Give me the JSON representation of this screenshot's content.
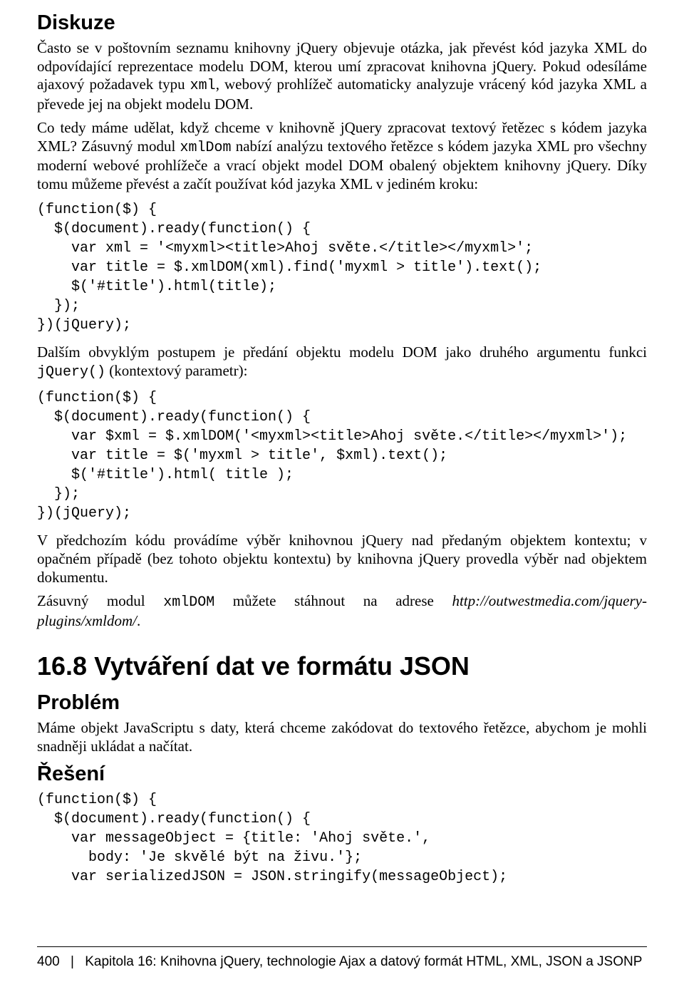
{
  "headings": {
    "diskuze": "Diskuze",
    "section": "16.8  Vytváření dat ve formátu JSON",
    "problem": "Problém",
    "reseni": "Řešení"
  },
  "p1a": "Často se v poštovním seznamu knihovny jQuery objevuje otázka, jak převést kód jazyka XML do odpovídající reprezentace modelu DOM, kterou umí zpracovat knihovna jQuery. Pokud odesíláme ajaxový požadavek typu ",
  "p1code": "xml",
  "p1b": ", webový prohlížeč automaticky analyzuje vrácený kód jazyka XML a převede jej na objekt modelu DOM.",
  "p2a": "Co tedy máme udělat, když chceme v knihovně jQuery zpracovat textový řetězec s kódem jazyka XML? Zásuvný modul ",
  "p2code": "xmlDom",
  "p2b": " nabízí analýzu textového řetězce s kódem jazyka XML pro všechny moderní webové prohlížeče a vrací objekt model DOM obalený objektem knihovny jQuery. Díky tomu můžeme převést a začít používat kód jazyka XML v jediném kroku:",
  "code1": "(function($) {\n  $(document).ready(function() {\n    var xml = '<myxml><title>Ahoj světe.</title></myxml>';\n    var title = $.xmlDOM(xml).find('myxml > title').text();\n    $('#title').html(title);\n  });\n})(jQuery);",
  "p3a": "Dalším obvyklým postupem je předání objektu modelu DOM jako druhého argumentu funkci ",
  "p3code": "jQuery()",
  "p3b": " (kontextový parametr):",
  "code2": "(function($) {\n  $(document).ready(function() {\n    var $xml = $.xmlDOM('<myxml><title>Ahoj světe.</title></myxml>');\n    var title = $('myxml > title', $xml).text();\n    $('#title').html( title );\n  });\n})(jQuery);",
  "p4": "V předchozím kódu provádíme výběr knihovnou jQuery nad předaným objektem kontextu; v opačném případě (bez tohoto objektu kontextu) by knihovna jQuery provedla výběr nad objektem dokumentu.",
  "p5a": "Zásuvný modul ",
  "p5code": "xmlDOM",
  "p5b": " můžete stáhnout na adrese ",
  "p5ital": "http://outwestmedia.com/jquery-plugins/xmldom/",
  "p5c": ".",
  "p6": "Máme objekt JavaScriptu s daty, která chceme zakódovat do textového řetězce, abychom je mohli snadněji ukládat a načítat.",
  "code3": "(function($) {\n  $(document).ready(function() {\n    var messageObject = {title: 'Ahoj světe.',\n      body: 'Je skvělé být na živu.'};\n    var serializedJSON = JSON.stringify(messageObject);",
  "footer": {
    "page": "400",
    "sep": "|",
    "chapter": "Kapitola 16: Knihovna jQuery, technologie Ajax a datový formát HTML, XML, JSON a JSONP"
  }
}
